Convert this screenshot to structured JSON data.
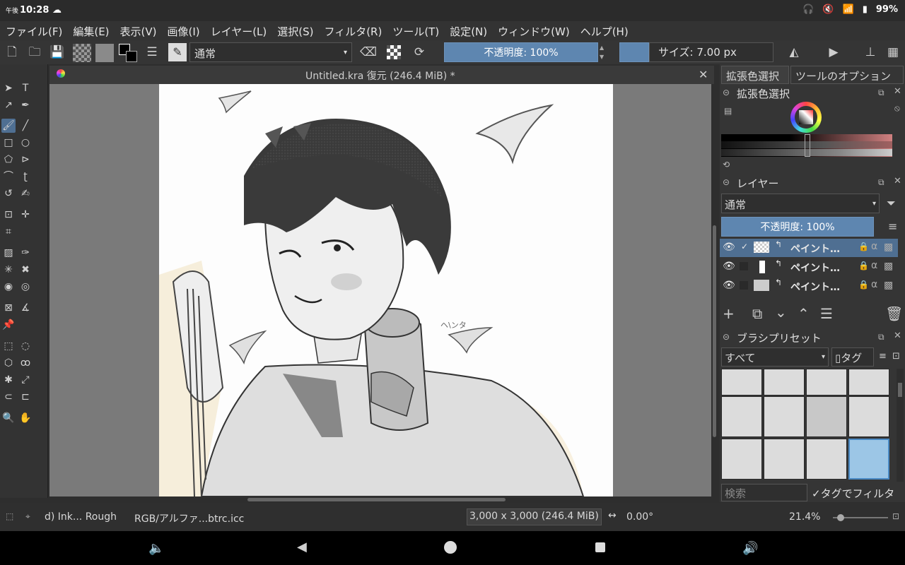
{
  "status_bar": {
    "time_prefix": "午後",
    "time": "10:28",
    "battery": "99%"
  },
  "menu": [
    "ファイル(F)",
    "編集(E)",
    "表示(V)",
    "画像(I)",
    "レイヤー(L)",
    "選択(S)",
    "フィルタ(R)",
    "ツール(T)",
    "設定(N)",
    "ウィンドウ(W)",
    "ヘルプ(H)"
  ],
  "toolbar": {
    "blend_mode": "通常",
    "opacity_label": "不透明度: 100%",
    "size_label": "サイズ: 7.00 px"
  },
  "document": {
    "tab_title": "Untitled.kra 復元 (246.4 MiB) *"
  },
  "dockers": {
    "tab_color": "拡張色選択",
    "tab_tool_options": "ツールのオプション",
    "color_title": "拡張色選択",
    "layers_title": "レイヤー",
    "layers_blend": "通常",
    "layers_opacity": "不透明度: 100%",
    "layers": [
      {
        "name": "ペイント…"
      },
      {
        "name": "ペイント…"
      },
      {
        "name": "ペイント…"
      }
    ],
    "brush_title": "ブラシプリセット",
    "brush_filter": "すべて",
    "brush_tag": "タグ",
    "search_placeholder": "検索",
    "filter_by_tag": "タグでフィルタ"
  },
  "bottom": {
    "brush_name": "d) Ink... Rough",
    "color_profile": "RGB/アルファ...btrc.icc",
    "image_size": "3,000 x 3,000 (246.4 MiB)",
    "rotation": "0.00°",
    "zoom": "21.4%"
  },
  "colors": {
    "accent": "#5e86b0",
    "selected_layer": "#4f6f92"
  }
}
